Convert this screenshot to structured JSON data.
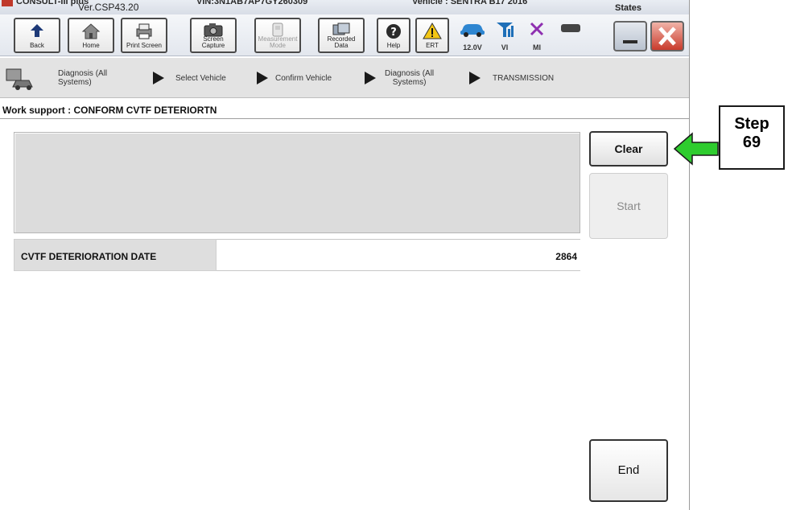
{
  "titlebar": {
    "app_name": "CONSULT-III plus",
    "version": "Ver.CSP43.20",
    "vin": "VIN:3N1AB7AP7GY260309",
    "vehicle": "Vehicle : SENTRA B17 2016",
    "region": "States"
  },
  "toolbar": {
    "back": "Back",
    "home": "Home",
    "print_screen": "Print Screen",
    "screen_capture_1": "Screen",
    "screen_capture_2": "Capture",
    "measurement_1": "Measurement",
    "measurement_2": "Mode",
    "recorded_1": "Recorded",
    "recorded_2": "Data",
    "help": "Help",
    "ert": "ERT",
    "battery_voltage": "12.0V",
    "vi": "VI",
    "mi": "MI"
  },
  "breadcrumb": {
    "diagnosis_1": "Diagnosis (All",
    "diagnosis_2": "Systems)",
    "select_vehicle": "Select Vehicle",
    "confirm_vehicle": "Confirm Vehicle",
    "diagnosis_all_1": "Diagnosis (All",
    "diagnosis_all_2": "Systems)",
    "transmission": "TRANSMISSION"
  },
  "work_support": {
    "title": "Work support : CONFORM CVTF DETERIORTN",
    "item_label": "CVTF DETERIORATION DATE",
    "item_value": "2864"
  },
  "buttons": {
    "clear": "Clear",
    "start": "Start",
    "end": "End"
  },
  "callout": {
    "line1": "Step",
    "line2": "69",
    "arrow_color": "#2ecc2e"
  }
}
